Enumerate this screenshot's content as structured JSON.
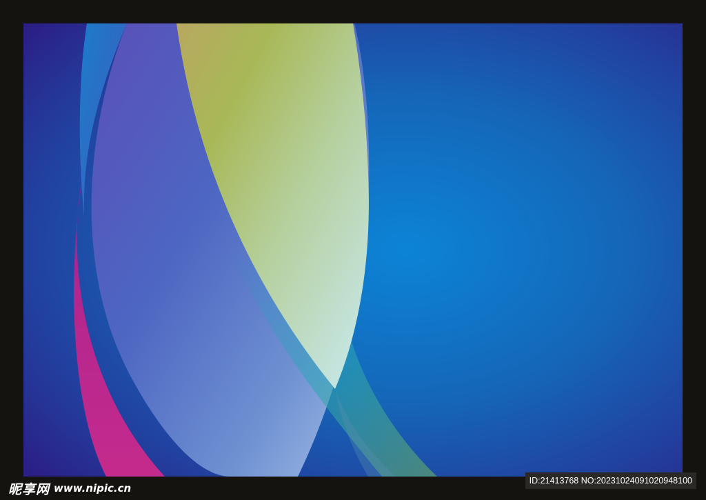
{
  "image": {
    "description_colors": {
      "frame": "#15130f",
      "background_center": "#0a7ed0",
      "background_edge": "#2a1d86",
      "magenta": "#c0258a",
      "lavender": "#8ea6e0",
      "yellow_green": "#a9b94f",
      "pale_cyan": "#bfe6ef"
    }
  },
  "watermark": {
    "logo_text": "昵享网",
    "url_text": "www.nipic.cn"
  },
  "badge": {
    "id_text": "ID:21413768 NO:20231024091020948100"
  }
}
